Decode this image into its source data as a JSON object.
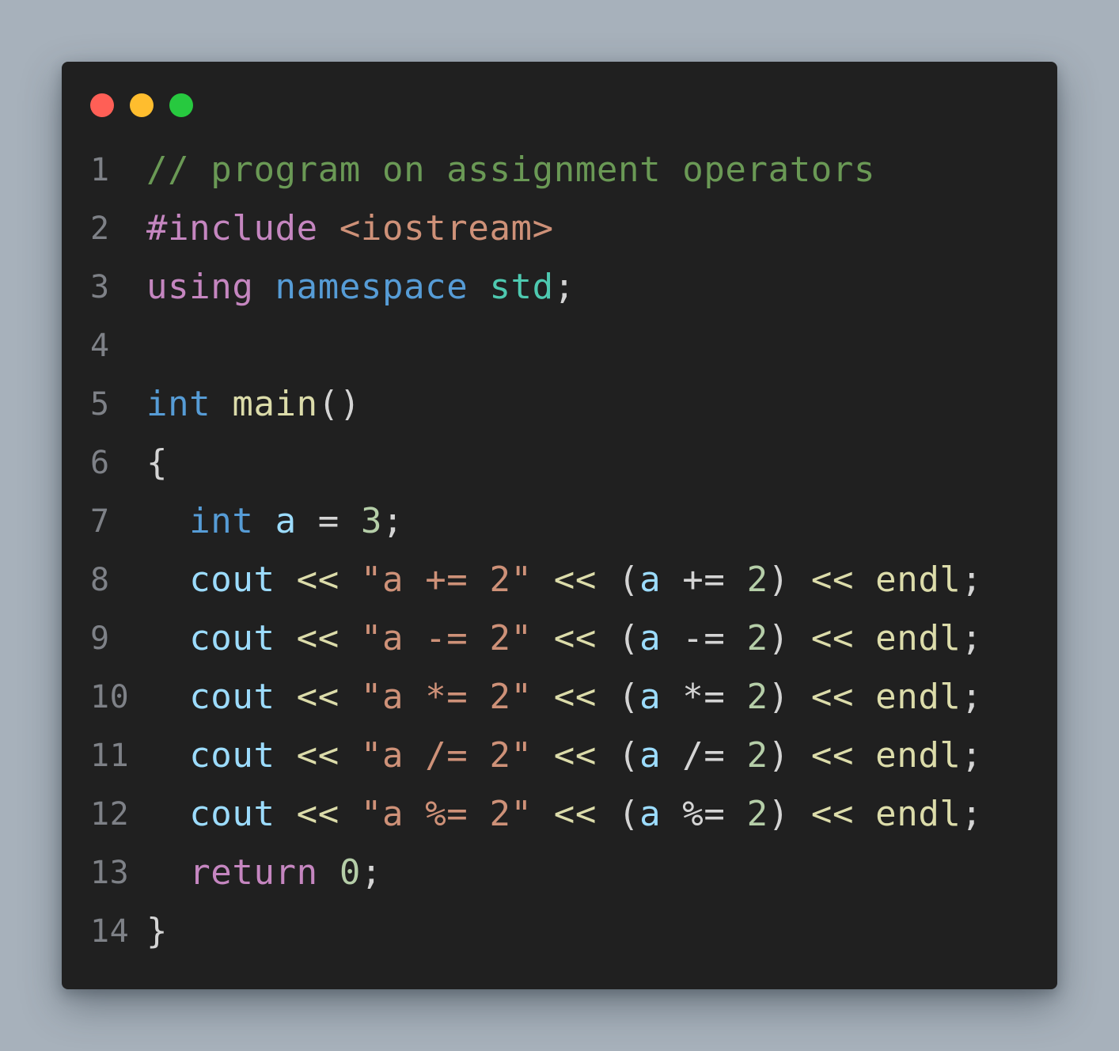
{
  "window": {
    "background": "#202020",
    "buttons": [
      {
        "name": "close-button",
        "color": "#ff5f56"
      },
      {
        "name": "minimize-button",
        "color": "#ffbd2e"
      },
      {
        "name": "maximize-button",
        "color": "#27c93f"
      }
    ]
  },
  "colors": {
    "comment": "#6a9955",
    "directive": "#c586c0",
    "string": "#ce9178",
    "keyword": "#569cd6",
    "namespace": "#4ec9b0",
    "function": "#dcdcaa",
    "variable": "#9cdcfe",
    "number": "#b5cea8",
    "operator": "#d4d4d4",
    "punct": "#d4d4d4",
    "control": "#c586c0",
    "line_number": "#7e8187"
  },
  "lines": [
    {
      "num": "1",
      "tokens": [
        {
          "t": "// program on assignment operators",
          "c": "comment"
        }
      ]
    },
    {
      "num": "2",
      "tokens": [
        {
          "t": "#include ",
          "c": "directive"
        },
        {
          "t": "<iostream>",
          "c": "string"
        }
      ]
    },
    {
      "num": "3",
      "tokens": [
        {
          "t": "using ",
          "c": "control"
        },
        {
          "t": "namespace ",
          "c": "keyword"
        },
        {
          "t": "std",
          "c": "namespace"
        },
        {
          "t": ";",
          "c": "punct"
        }
      ]
    },
    {
      "num": "4",
      "tokens": []
    },
    {
      "num": "5",
      "tokens": [
        {
          "t": "int ",
          "c": "keyword"
        },
        {
          "t": "main",
          "c": "function"
        },
        {
          "t": "()",
          "c": "punct"
        }
      ]
    },
    {
      "num": "6",
      "tokens": [
        {
          "t": "{",
          "c": "punct"
        }
      ]
    },
    {
      "num": "7",
      "tokens": [
        {
          "t": "  ",
          "c": "punct"
        },
        {
          "t": "int ",
          "c": "keyword"
        },
        {
          "t": "a ",
          "c": "variable"
        },
        {
          "t": "= ",
          "c": "operator"
        },
        {
          "t": "3",
          "c": "number"
        },
        {
          "t": ";",
          "c": "punct"
        }
      ]
    },
    {
      "num": "8",
      "tokens": [
        {
          "t": "  ",
          "c": "punct"
        },
        {
          "t": "cout ",
          "c": "variable"
        },
        {
          "t": "<< ",
          "c": "function"
        },
        {
          "t": "\"a += 2\" ",
          "c": "string"
        },
        {
          "t": "<< ",
          "c": "function"
        },
        {
          "t": "(",
          "c": "punct"
        },
        {
          "t": "a ",
          "c": "variable"
        },
        {
          "t": "+= ",
          "c": "operator"
        },
        {
          "t": "2",
          "c": "number"
        },
        {
          "t": ") ",
          "c": "punct"
        },
        {
          "t": "<< ",
          "c": "function"
        },
        {
          "t": "endl",
          "c": "function"
        },
        {
          "t": ";",
          "c": "punct"
        }
      ]
    },
    {
      "num": "9",
      "tokens": [
        {
          "t": "  ",
          "c": "punct"
        },
        {
          "t": "cout ",
          "c": "variable"
        },
        {
          "t": "<< ",
          "c": "function"
        },
        {
          "t": "\"a -= 2\" ",
          "c": "string"
        },
        {
          "t": "<< ",
          "c": "function"
        },
        {
          "t": "(",
          "c": "punct"
        },
        {
          "t": "a ",
          "c": "variable"
        },
        {
          "t": "-= ",
          "c": "operator"
        },
        {
          "t": "2",
          "c": "number"
        },
        {
          "t": ") ",
          "c": "punct"
        },
        {
          "t": "<< ",
          "c": "function"
        },
        {
          "t": "endl",
          "c": "function"
        },
        {
          "t": ";",
          "c": "punct"
        }
      ]
    },
    {
      "num": "10",
      "tokens": [
        {
          "t": "  ",
          "c": "punct"
        },
        {
          "t": "cout ",
          "c": "variable"
        },
        {
          "t": "<< ",
          "c": "function"
        },
        {
          "t": "\"a *= 2\" ",
          "c": "string"
        },
        {
          "t": "<< ",
          "c": "function"
        },
        {
          "t": "(",
          "c": "punct"
        },
        {
          "t": "a ",
          "c": "variable"
        },
        {
          "t": "*= ",
          "c": "operator"
        },
        {
          "t": "2",
          "c": "number"
        },
        {
          "t": ") ",
          "c": "punct"
        },
        {
          "t": "<< ",
          "c": "function"
        },
        {
          "t": "endl",
          "c": "function"
        },
        {
          "t": ";",
          "c": "punct"
        }
      ]
    },
    {
      "num": "11",
      "tokens": [
        {
          "t": "  ",
          "c": "punct"
        },
        {
          "t": "cout ",
          "c": "variable"
        },
        {
          "t": "<< ",
          "c": "function"
        },
        {
          "t": "\"a /= 2\" ",
          "c": "string"
        },
        {
          "t": "<< ",
          "c": "function"
        },
        {
          "t": "(",
          "c": "punct"
        },
        {
          "t": "a ",
          "c": "variable"
        },
        {
          "t": "/= ",
          "c": "operator"
        },
        {
          "t": "2",
          "c": "number"
        },
        {
          "t": ") ",
          "c": "punct"
        },
        {
          "t": "<< ",
          "c": "function"
        },
        {
          "t": "endl",
          "c": "function"
        },
        {
          "t": ";",
          "c": "punct"
        }
      ]
    },
    {
      "num": "12",
      "tokens": [
        {
          "t": "  ",
          "c": "punct"
        },
        {
          "t": "cout ",
          "c": "variable"
        },
        {
          "t": "<< ",
          "c": "function"
        },
        {
          "t": "\"a %= 2\" ",
          "c": "string"
        },
        {
          "t": "<< ",
          "c": "function"
        },
        {
          "t": "(",
          "c": "punct"
        },
        {
          "t": "a ",
          "c": "variable"
        },
        {
          "t": "%= ",
          "c": "operator"
        },
        {
          "t": "2",
          "c": "number"
        },
        {
          "t": ") ",
          "c": "punct"
        },
        {
          "t": "<< ",
          "c": "function"
        },
        {
          "t": "endl",
          "c": "function"
        },
        {
          "t": ";",
          "c": "punct"
        }
      ]
    },
    {
      "num": "13",
      "tokens": [
        {
          "t": "  ",
          "c": "punct"
        },
        {
          "t": "return ",
          "c": "control"
        },
        {
          "t": "0",
          "c": "number"
        },
        {
          "t": ";",
          "c": "punct"
        }
      ]
    },
    {
      "num": "14",
      "tokens": [
        {
          "t": "}",
          "c": "punct"
        }
      ]
    }
  ]
}
